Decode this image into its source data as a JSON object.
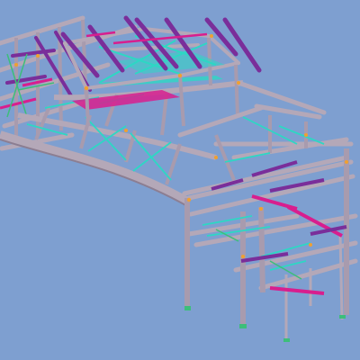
{
  "viewport": {
    "background_color": "#7E9FD0",
    "colors": {
      "steel_beam": "#B4A8B8",
      "steel_beam_shadow": "#8C7E92",
      "purlin_purple": "#7A2E9A",
      "magenta_member": "#D81E8E",
      "bracing_cyan": "#2ED7C4",
      "bracing_green": "#3DBE7A",
      "connection_orange": "#F0A030"
    }
  }
}
